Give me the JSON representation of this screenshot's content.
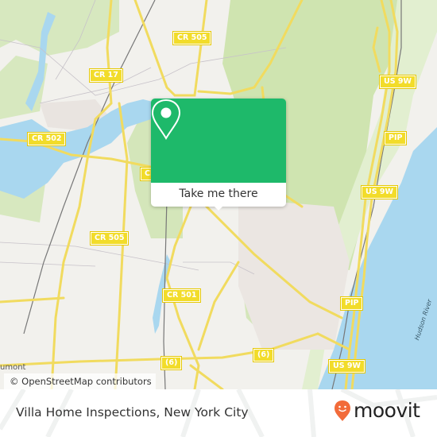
{
  "map": {
    "road_shields": [
      {
        "label": "CR 505"
      },
      {
        "label": "CR 17"
      },
      {
        "label": "CR 502"
      },
      {
        "label": "CR 505"
      },
      {
        "label": "CR 501"
      },
      {
        "label": "(6)"
      },
      {
        "label": "(6)"
      },
      {
        "label": "US 9W"
      },
      {
        "label": "PIP"
      },
      {
        "label": "US 9W"
      },
      {
        "label": "PIP"
      },
      {
        "label": "US 9W"
      },
      {
        "label": "CR"
      }
    ],
    "water_label": "Hudson River",
    "place_label": "umont",
    "attribution": "© OpenStreetMap contributors"
  },
  "popup": {
    "icon": "location-pin-icon",
    "button_label": "Take me there",
    "color": "#1eb96a"
  },
  "footer": {
    "title": "Villa Home Inspections, New York City",
    "brand": "moovit",
    "brand_color": "#f26b3a"
  }
}
